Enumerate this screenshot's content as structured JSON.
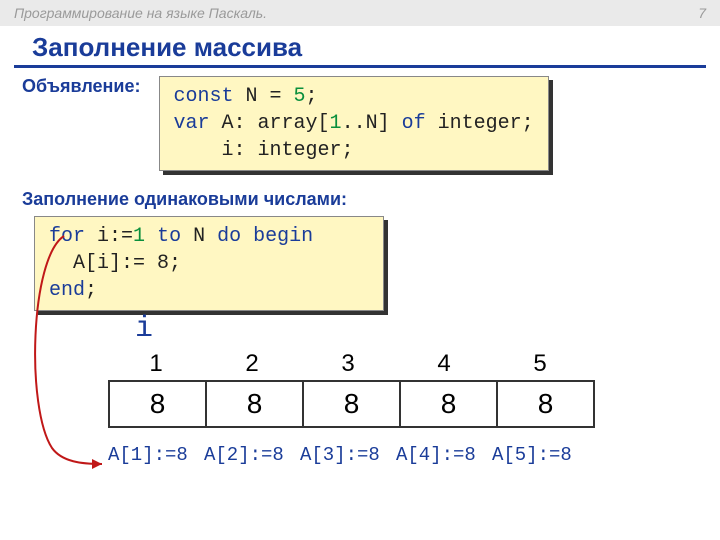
{
  "header": {
    "course": "Программирование на языке Паскаль.",
    "page": "7"
  },
  "title": "Заполнение массива",
  "declaration": {
    "label": "Объявление:",
    "code": {
      "l1_kw": "const",
      "l1_rest": " N = ",
      "l1_val": "5",
      "l1_end": ";",
      "l2_kw": "var",
      "l2_rest": " A: array[",
      "l2_lo": "1",
      "l2_mid": "..N] ",
      "l2_of": "of",
      "l2_type": " integer;",
      "l3": "    i: integer;"
    }
  },
  "fill": {
    "label": "Заполнение одинаковыми числами:",
    "code": {
      "l1_for": "for",
      "l1_a": " i:=",
      "l1_one": "1",
      "l1_b": " ",
      "l1_to": "to",
      "l1_c": " N ",
      "l1_do": "do",
      "l1_d": " ",
      "l1_begin": "begin",
      "l2": "  A[i]:= 8;",
      "l3": "end",
      "l3_semi": ";"
    }
  },
  "i_label": "i",
  "array": {
    "indices": [
      "1",
      "2",
      "3",
      "4",
      "5"
    ],
    "values": [
      "8",
      "8",
      "8",
      "8",
      "8"
    ],
    "assigns": [
      "A[1]:=8",
      "A[2]:=8",
      "A[3]:=8",
      "A[4]:=8",
      "A[5]:=8"
    ]
  }
}
